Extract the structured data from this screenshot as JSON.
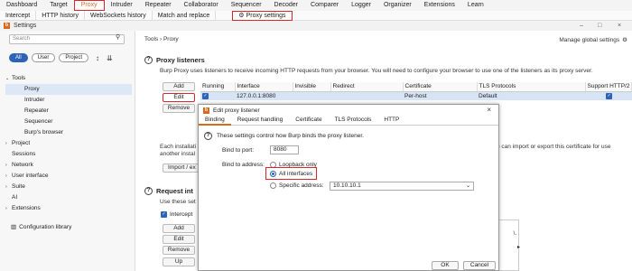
{
  "menubar": {
    "items": [
      "Dashboard",
      "Target",
      "Proxy",
      "Intruder",
      "Repeater",
      "Collaborator",
      "Sequencer",
      "Decoder",
      "Comparer",
      "Logger",
      "Organizer",
      "Extensions",
      "Learn"
    ],
    "active": "Proxy"
  },
  "subbar": {
    "items": [
      "Intercept",
      "HTTP history",
      "WebSockets history",
      "Match and replace"
    ],
    "active_label": "Proxy settings"
  },
  "settings_window": {
    "title": "Settings",
    "minimize": "–",
    "maximize": "□",
    "close": "×"
  },
  "sidebar": {
    "search_placeholder": "Search",
    "filters": [
      "All",
      "User",
      "Project"
    ],
    "tree": [
      {
        "label": "Tools",
        "level": 0,
        "caret": "v"
      },
      {
        "label": "Proxy",
        "level": 1,
        "selected": true
      },
      {
        "label": "Intruder",
        "level": 1
      },
      {
        "label": "Repeater",
        "level": 1
      },
      {
        "label": "Sequencer",
        "level": 1
      },
      {
        "label": "Burp's browser",
        "level": 1
      },
      {
        "label": "Project",
        "level": 0,
        "caret": ">"
      },
      {
        "label": "Sessions",
        "level": 0
      },
      {
        "label": "Network",
        "level": 0,
        "caret": ">"
      },
      {
        "label": "User interface",
        "level": 0,
        "caret": ">"
      },
      {
        "label": "Suite",
        "level": 0,
        "caret": ">"
      },
      {
        "label": "AI",
        "level": 0
      },
      {
        "label": "Extensions",
        "level": 0,
        "caret": ">"
      }
    ],
    "config_library": "Configuration library"
  },
  "main": {
    "breadcrumb": "Tools  ›  Proxy",
    "manage": "Manage global settings",
    "proxy_listeners": {
      "heading": "Proxy listeners",
      "desc": "Burp Proxy uses listeners to receive incoming HTTP requests from your browser. You will need to configure your browser to use one of the listeners as its proxy server.",
      "buttons": {
        "add": "Add",
        "edit": "Edit",
        "remove": "Remove"
      },
      "columns": [
        "Running",
        "Interface",
        "Invisible",
        "Redirect",
        "Certificate",
        "TLS Protocols",
        "Support HTTP/2"
      ],
      "row": {
        "running": true,
        "interface": "127.0.0.1:8080",
        "invisible": "",
        "redirect": "",
        "certificate": "Per-host",
        "tls": "Default",
        "http2": true
      }
    },
    "ca_text_1": "Each installati",
    "ca_text_2": "another instal",
    "ca_text_right": "u can import or export this certificate for use",
    "import_button": "Import / ex",
    "request_intercept": {
      "heading": "Request int",
      "desc": "Use these set",
      "intercept_label": "Intercept",
      "buttons": {
        "add": "Add",
        "edit": "Edit",
        "remove": "Remove",
        "up": "Up"
      },
      "table_snippet": "\\.",
      "arrow": "▸"
    }
  },
  "dialog": {
    "title": "Edit proxy listener",
    "close": "×",
    "tabs": [
      "Binding",
      "Request handling",
      "Certificate",
      "TLS Protocols",
      "HTTP"
    ],
    "active_tab": "Binding",
    "description": "These settings control how Burp binds the proxy listener.",
    "bind_port_label": "Bind to port:",
    "bind_port_value": "8080",
    "bind_address_label": "Bind to address:",
    "options": [
      "Loopback only",
      "All interfaces",
      "Specific address:"
    ],
    "selected_option": "All interfaces",
    "specific_address": "10.10.10.1",
    "ok": "OK",
    "cancel": "Cancel"
  },
  "colors": {
    "accent": "#d86a1e",
    "highlight": "#d9272e",
    "selection": "#2e64b7"
  }
}
